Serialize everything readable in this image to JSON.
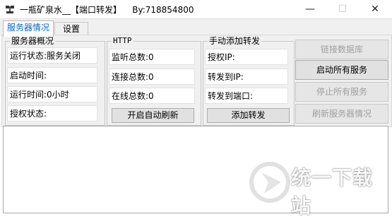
{
  "window": {
    "title": "一瓶矿泉水__【端口转发】    By:718854800",
    "controls": {
      "minimize": "—",
      "maximize": "☐",
      "close": "✕"
    }
  },
  "tabs": [
    {
      "label": "服务器情况",
      "active": true
    },
    {
      "label": "设置",
      "active": false
    }
  ],
  "overview": {
    "title": "服务器概况",
    "fields": [
      "运行状态:服务关闭",
      "启动时间:",
      "运行时间:0小时",
      "授权状态:"
    ]
  },
  "http": {
    "title": "HTTP",
    "fields": [
      "监听总数:0",
      "连接总数:0",
      "在线总数:0"
    ],
    "auto_refresh_button": "开启自动刷新"
  },
  "forward": {
    "title": "手动添加转发",
    "fields": [
      "授权IP:",
      "转发到IP:",
      "转发到端口:"
    ],
    "add_button": "添加转发"
  },
  "actions": [
    {
      "label": "链接数据库",
      "enabled": false
    },
    {
      "label": "启动所有服务",
      "enabled": true
    },
    {
      "label": "停止所有服务",
      "enabled": false
    },
    {
      "label": "刷新服务器情况",
      "enabled": false
    }
  ],
  "log": {
    "text": ""
  },
  "watermark": {
    "text": "统一下载站"
  },
  "colors": {
    "active_tab_text": "#0066cc",
    "panel_bg": "#f0f0f0",
    "button_bg": "#e1e1e1",
    "disabled_text": "#a0a0a0"
  }
}
